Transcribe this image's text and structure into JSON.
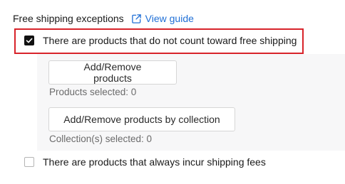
{
  "header": {
    "title": "Free shipping exceptions",
    "guide_link": "View guide",
    "guide_icon": "external-link-icon",
    "link_color": "#1f6fd6"
  },
  "options": [
    {
      "label": "There are products that do not count toward free shipping",
      "checked": true,
      "highlighted": true
    },
    {
      "label": "There are products that always incur shipping fees",
      "checked": false
    }
  ],
  "panel": {
    "products_button": "Add/Remove products",
    "products_selected": "Products selected: 0",
    "collection_button": "Add/Remove products by collection",
    "collections_selected": "Collection(s) selected: 0"
  },
  "colors": {
    "highlight_border": "#d8232a",
    "checkbox_checked": "#111111",
    "panel_background": "#f7f7f8"
  }
}
